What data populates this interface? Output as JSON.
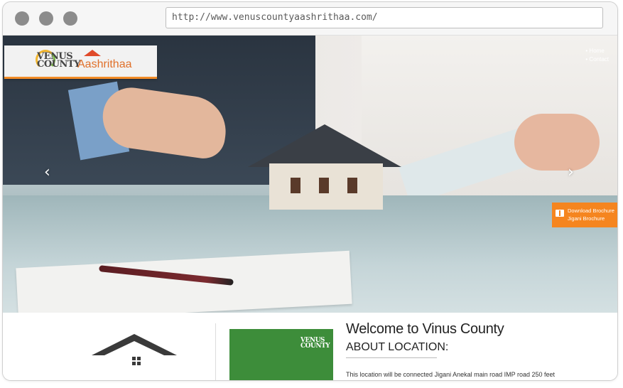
{
  "browser": {
    "url": "http://www.venuscountyaashrithaa.com/",
    "dot_color": "#8c8c8c"
  },
  "header": {
    "logo_venus": "VENUS COUNTY",
    "logo_aashrithaa": "Aashrithaa",
    "nav": [
      "Home",
      "Contact"
    ]
  },
  "carousel": {
    "prev_icon": "chevron-left-icon",
    "next_icon": "chevron-right-icon"
  },
  "brochure": {
    "line1": "Download Brochure",
    "line2": "Jigani Brochure",
    "icon": "book-icon",
    "color": "#f5851f"
  },
  "content": {
    "green_logo": "VENUS COUNTY",
    "welcome_title": "Welcome to Vinus County",
    "about_heading": "ABOUT LOCATION:",
    "about_text": "This location will be connected Jigani Anekal main road IMP road 250 feet"
  }
}
